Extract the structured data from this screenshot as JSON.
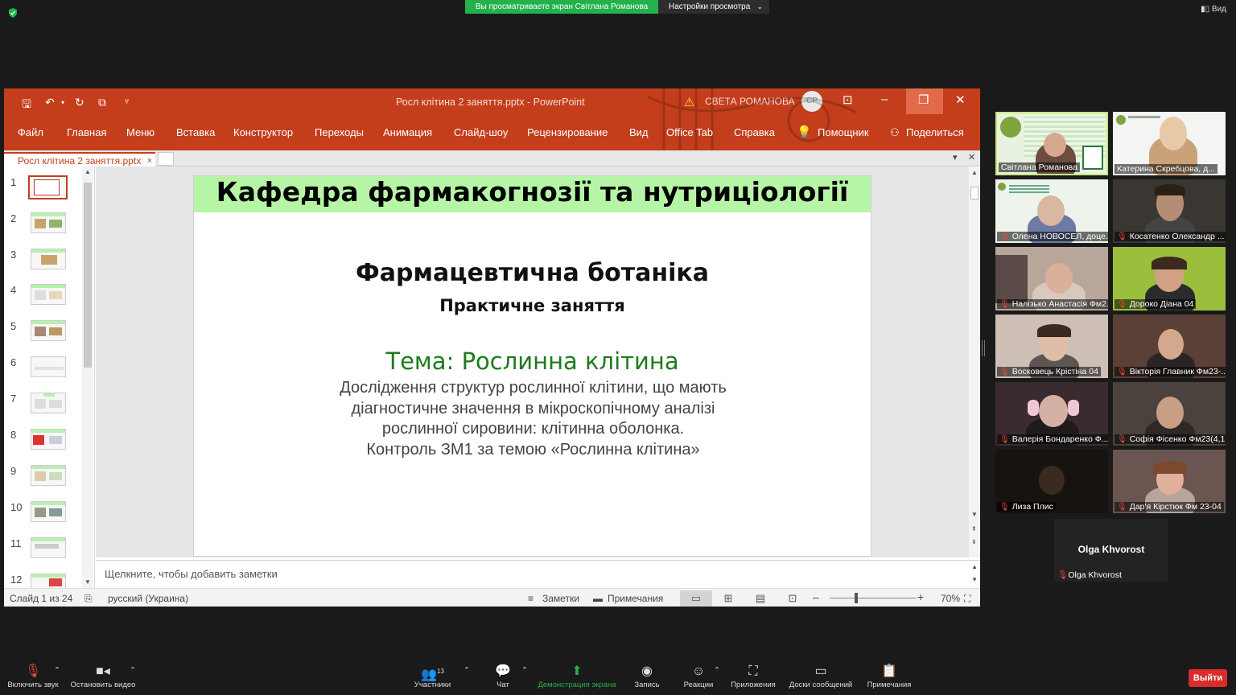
{
  "zoom": {
    "banner": "Вы просматриваете экран Світлана Романова",
    "view_settings": "Настройки просмотра",
    "view": "Вид",
    "leave": "Выйти",
    "participants_count": "13"
  },
  "ppt": {
    "doc_title": "Росл клітина 2 заняття.pptx  -  PowerPoint",
    "user_name": "СВЕТА РОМАНОВА",
    "user_initials": "СР",
    "tabs": [
      "Файл",
      "Главная",
      "Меню",
      "Вставка",
      "Конструктор",
      "Переходы",
      "Анимация",
      "Слайд-шоу",
      "Рецензирование",
      "Вид",
      "Office Tab",
      "Справка",
      "Помощник",
      "Поделиться"
    ],
    "doc_tab": "Росл клітина 2 заняття.pptx",
    "thumb_numbers": [
      "1",
      "2",
      "3",
      "4",
      "5",
      "6",
      "7",
      "8",
      "9",
      "10",
      "11",
      "12"
    ],
    "notes_placeholder": "Щелкните, чтобы добавить заметки",
    "status": {
      "slide_counter": "Слайд 1 из 24",
      "language": "русский (Украина)",
      "notes": "Заметки",
      "comments": "Примечания",
      "zoom": "70%",
      "zoom_level": 0.7
    }
  },
  "slide": {
    "header": "Кафедра фармакогнозії та нутриціології",
    "title": "Фармацевтична ботаніка",
    "subtitle": "Практичне заняття",
    "topic": "Тема: Рослинна клітина",
    "body": [
      "Дослідження структур рослинної клітини, що мають",
      "діагностичне значення в мікроскопічному аналізі",
      "рослинної сировини: клітинна оболонка.",
      "Контроль ЗМ1 за темою «Рослинна клітина»"
    ]
  },
  "participants": [
    "Світлана Романова",
    "Катерина Скребцова, д...",
    "Олена НОВОСЕЛ, доце...",
    "Косатенко Олександр ...",
    "Налізько Анастасія Фм2...",
    "Дороко Діана 04",
    "Восковець Крістіна 04",
    "Вікторія Главник Фм23-...",
    "Валерія Бондаренко Ф...",
    "Софія Фісенко Фм23(4,1...",
    "Лиза Плис",
    "Дар'я Кірстюк Фм 23-04"
  ],
  "olga": {
    "display": "Olga Khvorost",
    "name": "Olga Khvorost"
  },
  "toolbar": [
    "Включить звук",
    "Остановить видео",
    "Участники",
    "Чат",
    "Демонстрация экрана",
    "Запись",
    "Реакции",
    "Приложения",
    "Доски сообщений",
    "Примечания"
  ],
  "colors": {
    "ppt_accent": "#c43e1c",
    "zoom_green": "#23b14d",
    "slide_band": "#b6f5a6",
    "topic_green": "#1e7a1e",
    "leave_red": "#d92c2c"
  }
}
